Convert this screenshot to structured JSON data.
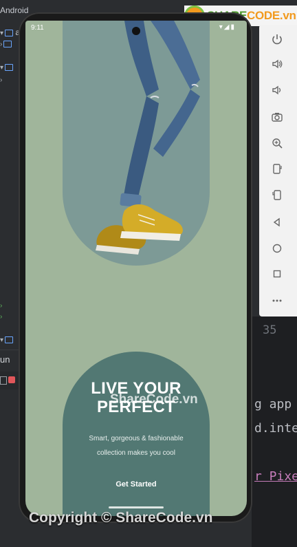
{
  "ide": {
    "top_tab": "Android",
    "tree_label": "ap",
    "run_label": "un",
    "line_number": "35",
    "code_lines": [
      "g app",
      "d.inte",
      "r Pixe"
    ]
  },
  "emulator": {
    "toolbar_icons": [
      "power-icon",
      "volume-up-icon",
      "volume-down-icon",
      "camera-icon",
      "zoom-icon",
      "rotate-left-icon",
      "rotate-right-icon",
      "back-icon",
      "home-icon",
      "overview-icon",
      "more-icon"
    ]
  },
  "phone": {
    "status_time": "9:11",
    "app": {
      "headline_line1": "LIVE YOUR",
      "headline_line2": "PERFECT",
      "subtitle_line1": "Smart, gorgeous & fashionable",
      "subtitle_line2": "collection makes you cool",
      "cta_label": "Get Started",
      "colors": {
        "background": "#a0b59b",
        "hero_pill": "#7d9a96",
        "card": "#527873"
      }
    }
  },
  "watermarks": {
    "badge_brand_main": "SHARE",
    "badge_brand_accent": "CODE.vn",
    "center": "ShareCode.vn",
    "bottom": "Copyright © ShareCode.vn"
  }
}
